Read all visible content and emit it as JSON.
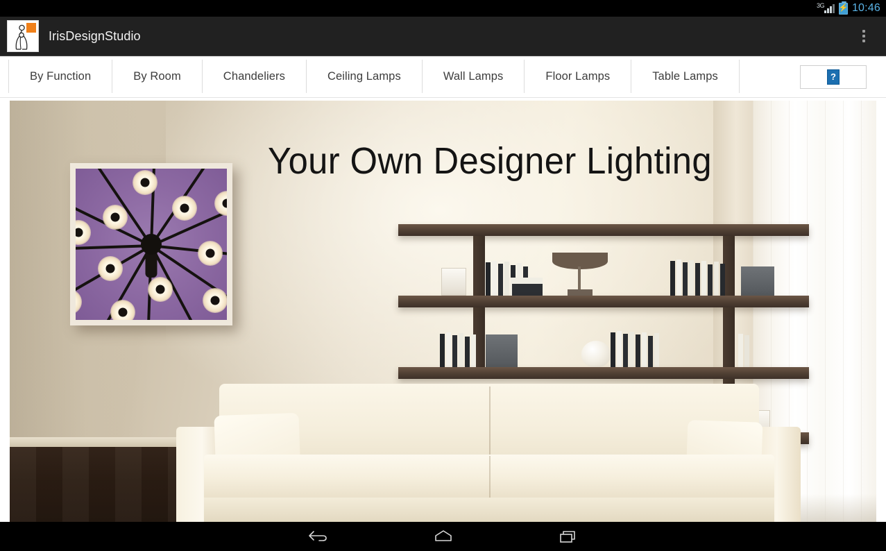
{
  "status_bar": {
    "network_label": "3G",
    "time": "10:46",
    "time_color": "#5ab3e6",
    "battery_state": "charging",
    "icons": [
      "signal-icon",
      "battery-charging-icon"
    ]
  },
  "action_bar": {
    "app_title": "IrisDesignStudio",
    "background": "#212121",
    "app_icon": "iris-logo-icon",
    "app_icon_accent": "#f08019",
    "overflow_label": "More options"
  },
  "tabs": [
    {
      "label": "By Function"
    },
    {
      "label": "By Room"
    },
    {
      "label": "Chandeliers"
    },
    {
      "label": "Ceiling Lamps"
    },
    {
      "label": "Wall Lamps"
    },
    {
      "label": "Floor Lamps"
    },
    {
      "label": "Table Lamps"
    }
  ],
  "tab_action": {
    "name": "help-button",
    "icon": "broken-image-icon",
    "icon_glyph": "?",
    "icon_color": "#1c6fb0"
  },
  "hero": {
    "headline": "Your Own Designer Lighting",
    "headline_color": "#141414",
    "artwork": {
      "name": "sputnik-chandelier-artwork",
      "background_color": "#8e6ba4",
      "frame_color": "#efe8dc",
      "arm_count": 11,
      "bulb_count": 11
    },
    "scene": {
      "wall_color": "#e6ddcc",
      "floor_color": "#2b1d13",
      "shelf_color": "#4f3f33",
      "sofa_color": "#f6efdd",
      "curtain_color": "#ffffff",
      "shelf_rows": 4
    }
  },
  "nav_bar": {
    "buttons": [
      {
        "name": "back-button",
        "icon": "back-arrow-icon"
      },
      {
        "name": "home-button",
        "icon": "home-icon"
      },
      {
        "name": "recents-button",
        "icon": "recents-icon"
      }
    ],
    "background": "#000000"
  }
}
